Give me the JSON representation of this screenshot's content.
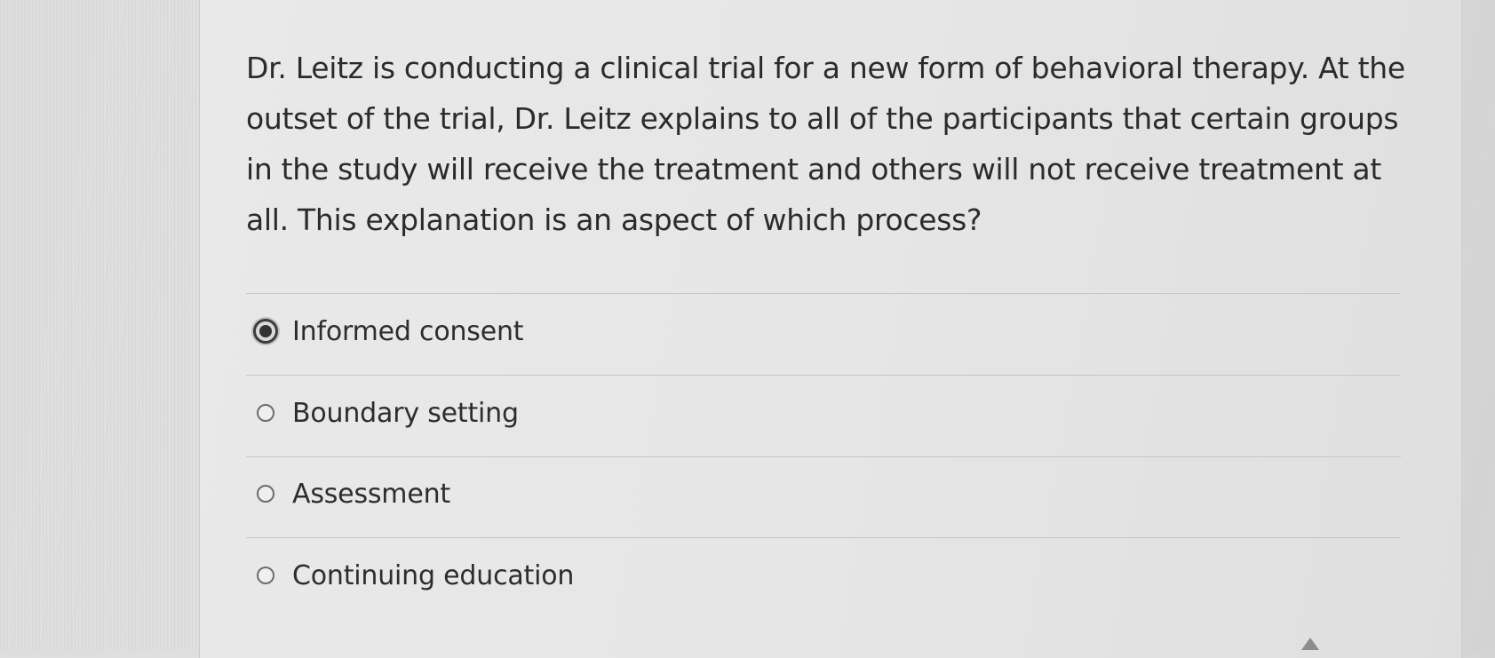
{
  "question": {
    "text": "Dr. Leitz is conducting a clinical trial for a new form of behavioral therapy. At the outset of the trial, Dr. Leitz explains to all of the participants that certain groups in the study will receive the treatment and others will not receive treatment at all. This explanation is an aspect of which process?"
  },
  "options": [
    {
      "label": "Informed consent",
      "selected": true
    },
    {
      "label": "Boundary setting",
      "selected": false
    },
    {
      "label": "Assessment",
      "selected": false
    },
    {
      "label": "Continuing education",
      "selected": false
    }
  ],
  "icons": {
    "selected_radio": "radio-checked-icon",
    "unselected_radio": "radio-unchecked-icon",
    "pointer": "mouse-pointer-icon"
  },
  "colors": {
    "background": "#dedede",
    "card": "#e8e8e8",
    "text": "#2b2b2b",
    "divider": "#c6c6c6"
  }
}
